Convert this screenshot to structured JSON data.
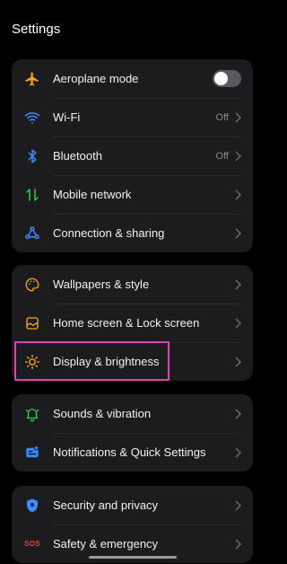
{
  "status_bar": {
    "ghost_text": ""
  },
  "header": {
    "title": "Settings"
  },
  "groups": [
    {
      "items": [
        {
          "label": "Aeroplane mode",
          "icon": "airplane-icon",
          "control": "toggle",
          "toggle_on": false
        },
        {
          "label": "Wi-Fi",
          "icon": "wifi-icon",
          "value": "Off"
        },
        {
          "label": "Bluetooth",
          "icon": "bluetooth-icon",
          "value": "Off"
        },
        {
          "label": "Mobile network",
          "icon": "mobile-network-icon"
        },
        {
          "label": "Connection & sharing",
          "icon": "connection-sharing-icon"
        }
      ]
    },
    {
      "items": [
        {
          "label": "Wallpapers & style",
          "icon": "palette-icon"
        },
        {
          "label": "Home screen & Lock screen",
          "icon": "home-screen-icon"
        },
        {
          "label": "Display & brightness",
          "icon": "brightness-icon"
        }
      ]
    },
    {
      "items": [
        {
          "label": "Sounds & vibration",
          "icon": "bell-icon"
        },
        {
          "label": "Notifications & Quick Settings",
          "icon": "notifications-icon"
        }
      ]
    },
    {
      "items": [
        {
          "label": "Security and privacy",
          "icon": "shield-icon"
        },
        {
          "label": "Safety & emergency",
          "icon": "sos-icon",
          "icon_text": "SOS"
        }
      ]
    }
  ],
  "colors": {
    "background": "#000000",
    "card": "#1c1c1e",
    "orange": "#f5a623",
    "blue": "#3d8bff",
    "green": "#34c759",
    "pink_highlight": "#e040b6",
    "sos_red": "#ff3b30"
  }
}
